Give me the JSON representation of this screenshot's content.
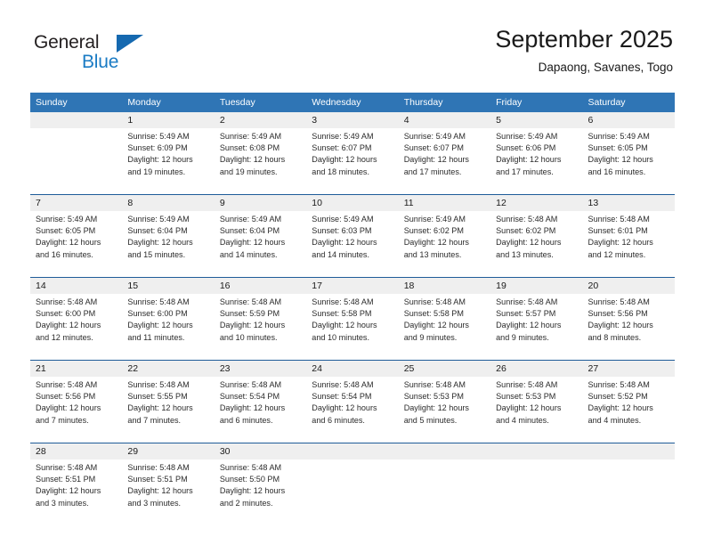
{
  "brand": {
    "name_part1": "General",
    "name_part2": "Blue",
    "triangle_color": "#1569b0",
    "blue_color": "#1a7bc4"
  },
  "header": {
    "title": "September 2025",
    "subtitle": "Dapaong, Savanes, Togo"
  },
  "theme": {
    "header_bg": "#2f75b5",
    "header_text": "#ffffff",
    "daynum_bg": "#efefef",
    "week_separator": "#1f5c99"
  },
  "day_headers": [
    "Sunday",
    "Monday",
    "Tuesday",
    "Wednesday",
    "Thursday",
    "Friday",
    "Saturday"
  ],
  "weeks": [
    {
      "days": [
        {
          "num": "",
          "sunrise": "",
          "sunset": "",
          "daylight_line1": "",
          "daylight_line2": ""
        },
        {
          "num": "1",
          "sunrise": "Sunrise: 5:49 AM",
          "sunset": "Sunset: 6:09 PM",
          "daylight_line1": "Daylight: 12 hours",
          "daylight_line2": "and 19 minutes."
        },
        {
          "num": "2",
          "sunrise": "Sunrise: 5:49 AM",
          "sunset": "Sunset: 6:08 PM",
          "daylight_line1": "Daylight: 12 hours",
          "daylight_line2": "and 19 minutes."
        },
        {
          "num": "3",
          "sunrise": "Sunrise: 5:49 AM",
          "sunset": "Sunset: 6:07 PM",
          "daylight_line1": "Daylight: 12 hours",
          "daylight_line2": "and 18 minutes."
        },
        {
          "num": "4",
          "sunrise": "Sunrise: 5:49 AM",
          "sunset": "Sunset: 6:07 PM",
          "daylight_line1": "Daylight: 12 hours",
          "daylight_line2": "and 17 minutes."
        },
        {
          "num": "5",
          "sunrise": "Sunrise: 5:49 AM",
          "sunset": "Sunset: 6:06 PM",
          "daylight_line1": "Daylight: 12 hours",
          "daylight_line2": "and 17 minutes."
        },
        {
          "num": "6",
          "sunrise": "Sunrise: 5:49 AM",
          "sunset": "Sunset: 6:05 PM",
          "daylight_line1": "Daylight: 12 hours",
          "daylight_line2": "and 16 minutes."
        }
      ]
    },
    {
      "days": [
        {
          "num": "7",
          "sunrise": "Sunrise: 5:49 AM",
          "sunset": "Sunset: 6:05 PM",
          "daylight_line1": "Daylight: 12 hours",
          "daylight_line2": "and 16 minutes."
        },
        {
          "num": "8",
          "sunrise": "Sunrise: 5:49 AM",
          "sunset": "Sunset: 6:04 PM",
          "daylight_line1": "Daylight: 12 hours",
          "daylight_line2": "and 15 minutes."
        },
        {
          "num": "9",
          "sunrise": "Sunrise: 5:49 AM",
          "sunset": "Sunset: 6:04 PM",
          "daylight_line1": "Daylight: 12 hours",
          "daylight_line2": "and 14 minutes."
        },
        {
          "num": "10",
          "sunrise": "Sunrise: 5:49 AM",
          "sunset": "Sunset: 6:03 PM",
          "daylight_line1": "Daylight: 12 hours",
          "daylight_line2": "and 14 minutes."
        },
        {
          "num": "11",
          "sunrise": "Sunrise: 5:49 AM",
          "sunset": "Sunset: 6:02 PM",
          "daylight_line1": "Daylight: 12 hours",
          "daylight_line2": "and 13 minutes."
        },
        {
          "num": "12",
          "sunrise": "Sunrise: 5:48 AM",
          "sunset": "Sunset: 6:02 PM",
          "daylight_line1": "Daylight: 12 hours",
          "daylight_line2": "and 13 minutes."
        },
        {
          "num": "13",
          "sunrise": "Sunrise: 5:48 AM",
          "sunset": "Sunset: 6:01 PM",
          "daylight_line1": "Daylight: 12 hours",
          "daylight_line2": "and 12 minutes."
        }
      ]
    },
    {
      "days": [
        {
          "num": "14",
          "sunrise": "Sunrise: 5:48 AM",
          "sunset": "Sunset: 6:00 PM",
          "daylight_line1": "Daylight: 12 hours",
          "daylight_line2": "and 12 minutes."
        },
        {
          "num": "15",
          "sunrise": "Sunrise: 5:48 AM",
          "sunset": "Sunset: 6:00 PM",
          "daylight_line1": "Daylight: 12 hours",
          "daylight_line2": "and 11 minutes."
        },
        {
          "num": "16",
          "sunrise": "Sunrise: 5:48 AM",
          "sunset": "Sunset: 5:59 PM",
          "daylight_line1": "Daylight: 12 hours",
          "daylight_line2": "and 10 minutes."
        },
        {
          "num": "17",
          "sunrise": "Sunrise: 5:48 AM",
          "sunset": "Sunset: 5:58 PM",
          "daylight_line1": "Daylight: 12 hours",
          "daylight_line2": "and 10 minutes."
        },
        {
          "num": "18",
          "sunrise": "Sunrise: 5:48 AM",
          "sunset": "Sunset: 5:58 PM",
          "daylight_line1": "Daylight: 12 hours",
          "daylight_line2": "and 9 minutes."
        },
        {
          "num": "19",
          "sunrise": "Sunrise: 5:48 AM",
          "sunset": "Sunset: 5:57 PM",
          "daylight_line1": "Daylight: 12 hours",
          "daylight_line2": "and 9 minutes."
        },
        {
          "num": "20",
          "sunrise": "Sunrise: 5:48 AM",
          "sunset": "Sunset: 5:56 PM",
          "daylight_line1": "Daylight: 12 hours",
          "daylight_line2": "and 8 minutes."
        }
      ]
    },
    {
      "days": [
        {
          "num": "21",
          "sunrise": "Sunrise: 5:48 AM",
          "sunset": "Sunset: 5:56 PM",
          "daylight_line1": "Daylight: 12 hours",
          "daylight_line2": "and 7 minutes."
        },
        {
          "num": "22",
          "sunrise": "Sunrise: 5:48 AM",
          "sunset": "Sunset: 5:55 PM",
          "daylight_line1": "Daylight: 12 hours",
          "daylight_line2": "and 7 minutes."
        },
        {
          "num": "23",
          "sunrise": "Sunrise: 5:48 AM",
          "sunset": "Sunset: 5:54 PM",
          "daylight_line1": "Daylight: 12 hours",
          "daylight_line2": "and 6 minutes."
        },
        {
          "num": "24",
          "sunrise": "Sunrise: 5:48 AM",
          "sunset": "Sunset: 5:54 PM",
          "daylight_line1": "Daylight: 12 hours",
          "daylight_line2": "and 6 minutes."
        },
        {
          "num": "25",
          "sunrise": "Sunrise: 5:48 AM",
          "sunset": "Sunset: 5:53 PM",
          "daylight_line1": "Daylight: 12 hours",
          "daylight_line2": "and 5 minutes."
        },
        {
          "num": "26",
          "sunrise": "Sunrise: 5:48 AM",
          "sunset": "Sunset: 5:53 PM",
          "daylight_line1": "Daylight: 12 hours",
          "daylight_line2": "and 4 minutes."
        },
        {
          "num": "27",
          "sunrise": "Sunrise: 5:48 AM",
          "sunset": "Sunset: 5:52 PM",
          "daylight_line1": "Daylight: 12 hours",
          "daylight_line2": "and 4 minutes."
        }
      ]
    },
    {
      "days": [
        {
          "num": "28",
          "sunrise": "Sunrise: 5:48 AM",
          "sunset": "Sunset: 5:51 PM",
          "daylight_line1": "Daylight: 12 hours",
          "daylight_line2": "and 3 minutes."
        },
        {
          "num": "29",
          "sunrise": "Sunrise: 5:48 AM",
          "sunset": "Sunset: 5:51 PM",
          "daylight_line1": "Daylight: 12 hours",
          "daylight_line2": "and 3 minutes."
        },
        {
          "num": "30",
          "sunrise": "Sunrise: 5:48 AM",
          "sunset": "Sunset: 5:50 PM",
          "daylight_line1": "Daylight: 12 hours",
          "daylight_line2": "and 2 minutes."
        },
        {
          "num": "",
          "sunrise": "",
          "sunset": "",
          "daylight_line1": "",
          "daylight_line2": ""
        },
        {
          "num": "",
          "sunrise": "",
          "sunset": "",
          "daylight_line1": "",
          "daylight_line2": ""
        },
        {
          "num": "",
          "sunrise": "",
          "sunset": "",
          "daylight_line1": "",
          "daylight_line2": ""
        },
        {
          "num": "",
          "sunrise": "",
          "sunset": "",
          "daylight_line1": "",
          "daylight_line2": ""
        }
      ]
    }
  ]
}
